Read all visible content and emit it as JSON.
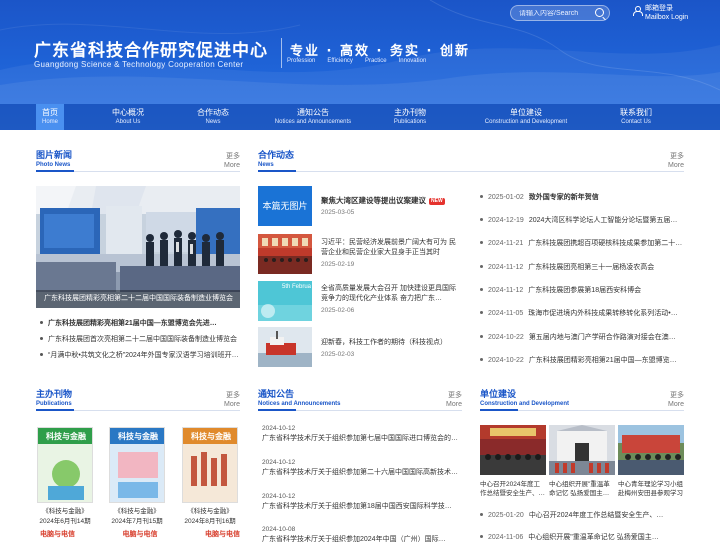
{
  "header": {
    "logo_cn": "广东省科技合作研究促进中心",
    "logo_en": "Guangdong Science & Technology Cooperation Center",
    "slogan_cn": "专业 · 高效 · 务实 · 创新",
    "slogan_en": [
      "Profession",
      "Efficiency",
      "Practice",
      "Innovation"
    ],
    "search_placeholder": "请输入内容/Search",
    "mailbox_cn": "邮箱登录",
    "mailbox_en": "Mailbox Login"
  },
  "nav": [
    {
      "cn": "首页",
      "en": "Home",
      "active": true
    },
    {
      "cn": "中心概况",
      "en": "About Us"
    },
    {
      "cn": "合作动态",
      "en": "News"
    },
    {
      "cn": "通知公告",
      "en": "Notices and Announcements"
    },
    {
      "cn": "主办刊物",
      "en": "Publications"
    },
    {
      "cn": "单位建设",
      "en": "Construction and Development"
    },
    {
      "cn": "联系我们",
      "en": "Contact Us"
    }
  ],
  "more": {
    "cn": "更多",
    "en": "More"
  },
  "photo_news": {
    "title_cn": "图片新闻",
    "title_en": "Photo News",
    "caption": "广东科技展团精彩亮相第二十二届中国国际装备制造业博览会",
    "items": [
      "广东科技展团精彩亮相第21届中国—东盟博览会先进…",
      "广东科技展团首次亮相第二十二届中国国际装备制造业博览会",
      "“月满中秋•共筑文化之桥”2024年外国专家汉语学习培训班开…"
    ]
  },
  "news": {
    "title_cn": "合作动态",
    "title_en": "News",
    "thumb1_label": "本篇无图片",
    "thumb3_label": "5th Februa",
    "items": [
      {
        "title": "聚焦大湾区建设等提出议案建议",
        "badge": "NEW",
        "date": "2025-03-05"
      },
      {
        "title": "习近平：民营经济发展前景广阔大有可为 民营企业和民营企业家大显身手正当其时",
        "date": "2025-02-19"
      },
      {
        "title": "全省高质量发展大会召开 加快建设更具国际竞争力的现代化产业体系 奋力把广东…",
        "date": "2025-02-06"
      },
      {
        "title": "迎新春，科技工作者的期待（科技视点）",
        "date": "2025-02-03"
      }
    ],
    "right_list": [
      {
        "date": "2025-01-02",
        "title": "致外国专家的新年贺信",
        "bold": true
      },
      {
        "date": "2024-12-19",
        "title": "2024大湾区科学论坛人工智能分论坛暨第五届…"
      },
      {
        "date": "2024-11-21",
        "title": "广东科技展团携超百项硬核科技成果参加第二十…"
      },
      {
        "date": "2024-11-12",
        "title": "广东科技展团亮相第三十一届杨凌农高会"
      },
      {
        "date": "2024-11-12",
        "title": "广东科技展团参展第18届西安科博会"
      },
      {
        "date": "2024-11-05",
        "title": "珠海市促进境内外科技成果转移转化系列活动•…"
      },
      {
        "date": "2024-10-22",
        "title": "第五届内地与澳门产学研合作路演对接会在澳…"
      },
      {
        "date": "2024-10-22",
        "title": "广东科技展团精彩亮相第21届中国—东盟博览…"
      }
    ]
  },
  "publications": {
    "title_cn": "主办刊物",
    "title_en": "Publications",
    "books": [
      {
        "name": "《科技与金融》",
        "issue": "2024年6月刊14期",
        "cover": "科技与金融"
      },
      {
        "name": "《科技与金融》",
        "issue": "2024年7月刊15期",
        "cover": "科技与金融"
      },
      {
        "name": "《科技与金融》",
        "issue": "2024年8月刊16期",
        "cover": "科技与金融"
      }
    ],
    "footer_label": "电脑与电信"
  },
  "notices": {
    "title_cn": "通知公告",
    "title_en": "Notices and Announcements",
    "items": [
      {
        "date": "2024-10-12",
        "title": "广东省科学技术厅关于组织参加第七届中国国际进口博览会的…"
      },
      {
        "date": "2024-10-12",
        "title": "广东省科学技术厅关于组织参加第二十六届中国国际高新技术…"
      },
      {
        "date": "2024-10-12",
        "title": "广东省科学技术厅关于组织参加第18届中国西安国际科学技…"
      },
      {
        "date": "2024-10-08",
        "title": "广东省科学技术厅关于组织参加2024年中国（广州）国际…"
      }
    ]
  },
  "construction": {
    "title_cn": "单位建设",
    "title_en": "Construction and Development",
    "photos": [
      {
        "caption": "中心召开2024年度工作总结暨安全生产、…"
      },
      {
        "caption": "中心组织开展\"重温革命记忆 弘扬爱国主…"
      },
      {
        "caption": "中心青年理论学习小组赴梅州安田县参观学习"
      }
    ],
    "list": [
      {
        "date": "2025-01-20",
        "title": "中心召开2024年度工作总结暨安全生产、…"
      },
      {
        "date": "2024-11-06",
        "title": "中心组织开展\"重温革命记忆 弘扬爱国主…"
      }
    ]
  },
  "colors": {
    "brand_blue": "#1a56c8",
    "header_blue": "#1f64d8",
    "nav_active": "#4a90f0",
    "badge_red": "#e5322d"
  }
}
